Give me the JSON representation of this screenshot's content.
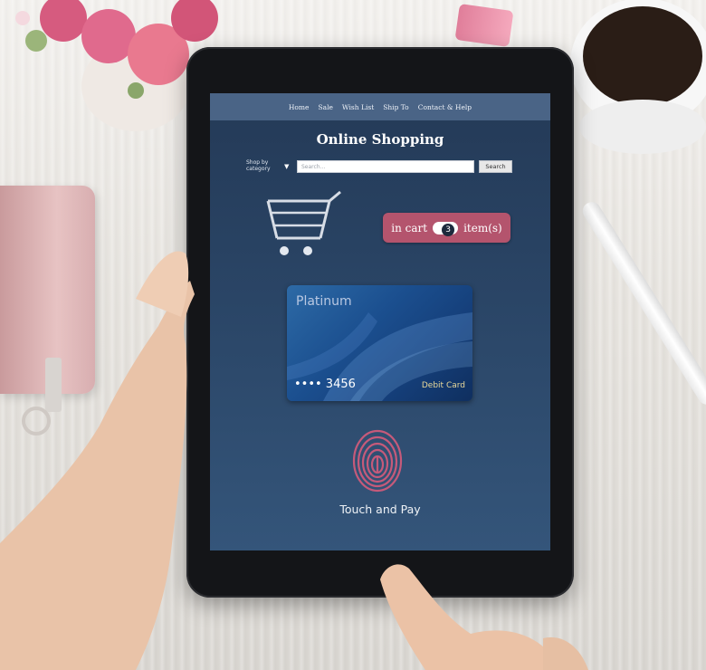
{
  "nav": {
    "items": [
      "Home",
      "Sale",
      "Wish List",
      "Ship To",
      "Contact & Help"
    ]
  },
  "header": {
    "title": "Online Shopping"
  },
  "search": {
    "category_label": "Shop by category",
    "placeholder": "Search...",
    "button_label": "Search"
  },
  "cart": {
    "prefix": "in cart",
    "count": "3",
    "suffix": "item(s)"
  },
  "payment_card": {
    "tier": "Platinum",
    "number": "•••• 3456",
    "type": "Debit Card"
  },
  "pay": {
    "label": "Touch and Pay"
  },
  "colors": {
    "screen_bg": "#2a4566",
    "nav_bg": "#4a6486",
    "badge": "#b4546d",
    "fingerprint": "#b4546d"
  }
}
